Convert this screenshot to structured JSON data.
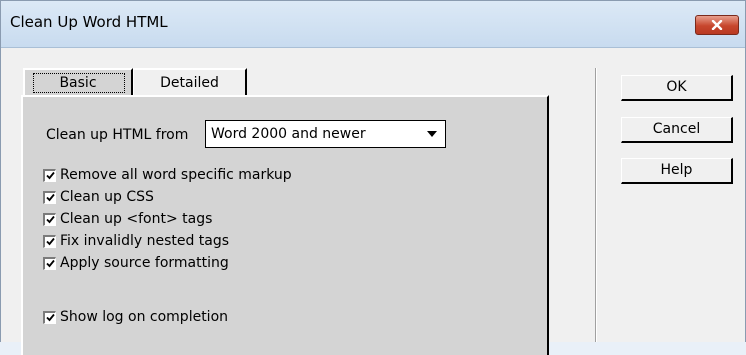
{
  "window": {
    "title": "Clean Up Word HTML"
  },
  "tabs": [
    {
      "label": "Basic",
      "selected": true
    },
    {
      "label": "Detailed",
      "selected": false
    }
  ],
  "basic": {
    "cleanup_from_label": "Clean up HTML from",
    "cleanup_from_value": "Word 2000 and newer",
    "options": [
      {
        "label": "Remove all word specific markup",
        "checked": true
      },
      {
        "label": "Clean up CSS",
        "checked": true
      },
      {
        "label": "Clean up <font> tags",
        "checked": true
      },
      {
        "label": "Fix invalidly nested tags",
        "checked": true
      },
      {
        "label": "Apply source formatting",
        "checked": true
      }
    ],
    "show_log": {
      "label": "Show log on completion",
      "checked": true
    }
  },
  "buttons": {
    "ok": "OK",
    "cancel": "Cancel",
    "help": "Help"
  },
  "colors": {
    "close_button": "#c7462d",
    "titlebar": "#dce9f6",
    "panel": "#d4d4d4"
  }
}
